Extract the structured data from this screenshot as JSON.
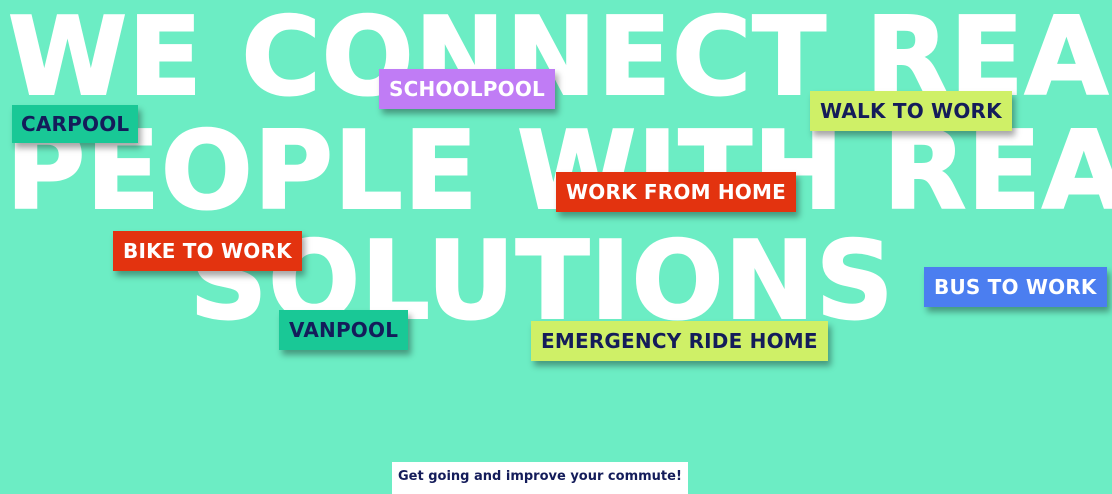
{
  "headline": {
    "line1": "WE CONNECT REAL",
    "line2": "PEOPLE WITH REAL",
    "line3": "SOLUTIONS"
  },
  "tags": {
    "schoolpool": "SCHOOLPOOL",
    "carpool": "CARPOOL",
    "walk_to_work": "WALK TO WORK",
    "work_from_home": "WORK FROM HOME",
    "bike_to_work": "BIKE TO WORK",
    "bus_to_work": "BUS TO WORK",
    "vanpool": "VANPOOL",
    "emergency_ride_home": "EMERGENCY RIDE HOME"
  },
  "cta": {
    "label": "Get going and improve your commute!"
  },
  "colors": {
    "background": "#6cedc4",
    "navy": "#141c5a",
    "purple": "#c07cf5",
    "teal": "#19c896",
    "lime": "#cff067",
    "red": "#e3330f",
    "blue": "#4b7ef0"
  }
}
